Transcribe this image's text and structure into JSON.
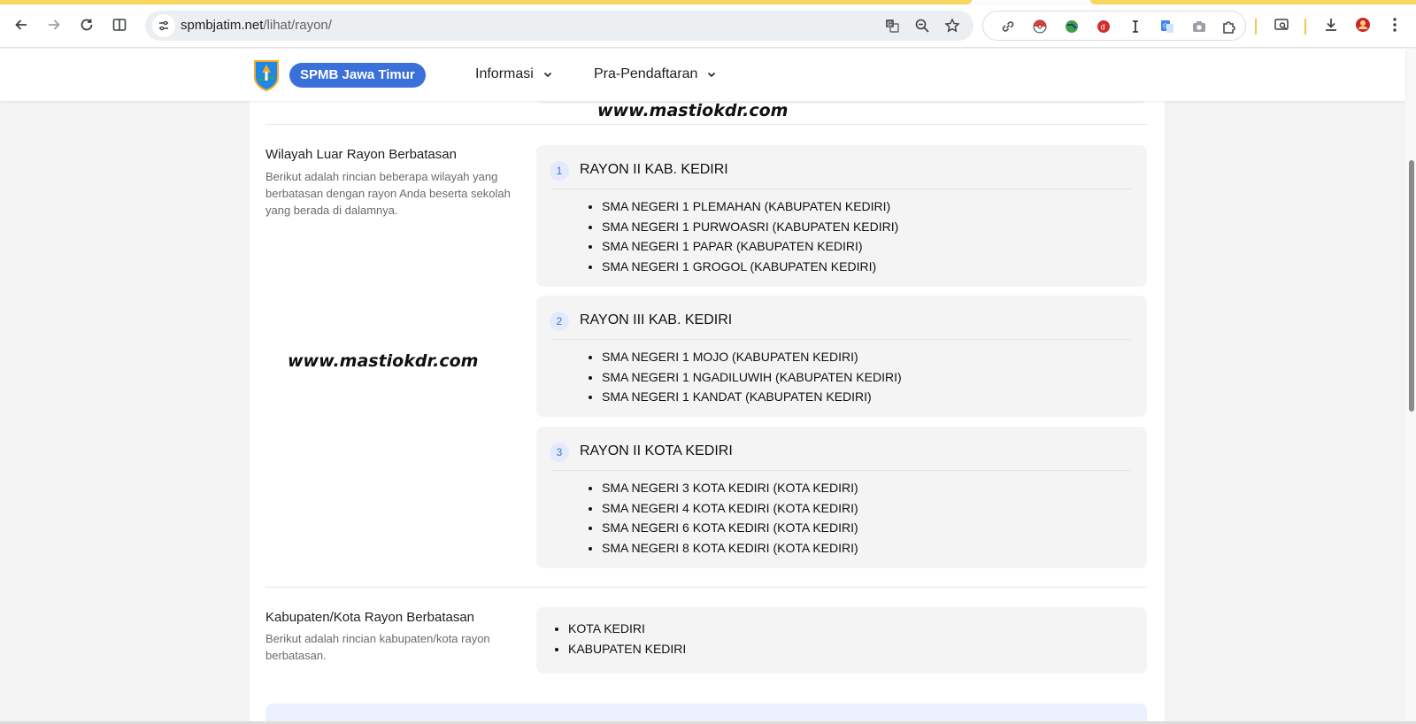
{
  "browser": {
    "url_host": "spmbjatim.net",
    "url_path": "/lihat/rayon/"
  },
  "header": {
    "brand": "SPMB Jawa Timur",
    "menu": [
      {
        "label": "Informasi"
      },
      {
        "label": "Pra-Pendaftaran"
      }
    ]
  },
  "watermark": "www.mastiokdr.com",
  "sections": {
    "wilayah": {
      "title": "Wilayah Luar Rayon Berbatasan",
      "description": "Berikut adalah rincian beberapa wilayah yang berbatasan dengan rayon Anda beserta sekolah yang berada di dalamnya.",
      "rayons": [
        {
          "number": "1",
          "name": "RAYON II KAB. KEDIRI",
          "schools": [
            "SMA NEGERI 1 PLEMAHAN (KABUPATEN KEDIRI)",
            "SMA NEGERI 1 PURWOASRI (KABUPATEN KEDIRI)",
            "SMA NEGERI 1 PAPAR (KABUPATEN KEDIRI)",
            "SMA NEGERI 1 GROGOL (KABUPATEN KEDIRI)"
          ]
        },
        {
          "number": "2",
          "name": "RAYON III KAB. KEDIRI",
          "schools": [
            "SMA NEGERI 1 MOJO (KABUPATEN KEDIRI)",
            "SMA NEGERI 1 NGADILUWIH (KABUPATEN KEDIRI)",
            "SMA NEGERI 1 KANDAT (KABUPATEN KEDIRI)"
          ]
        },
        {
          "number": "3",
          "name": "RAYON II KOTA KEDIRI",
          "schools": [
            "SMA NEGERI 3 KOTA KEDIRI (KOTA KEDIRI)",
            "SMA NEGERI 4 KOTA KEDIRI (KOTA KEDIRI)",
            "SMA NEGERI 6 KOTA KEDIRI (KOTA KEDIRI)",
            "SMA NEGERI 8 KOTA KEDIRI (KOTA KEDIRI)"
          ]
        }
      ]
    },
    "kabupaten": {
      "title": "Kabupaten/Kota Rayon Berbatasan",
      "description": "Berikut adalah rincian kabupaten/kota rayon berbatasan.",
      "items": [
        "KOTA KEDIRI",
        "KABUPATEN KEDIRI"
      ]
    }
  },
  "colors": {
    "accent": "#3b6fd9",
    "badge_bg": "#e3ebfb",
    "card_bg": "#f4f4f4",
    "tab_strip": "#f7d760"
  }
}
